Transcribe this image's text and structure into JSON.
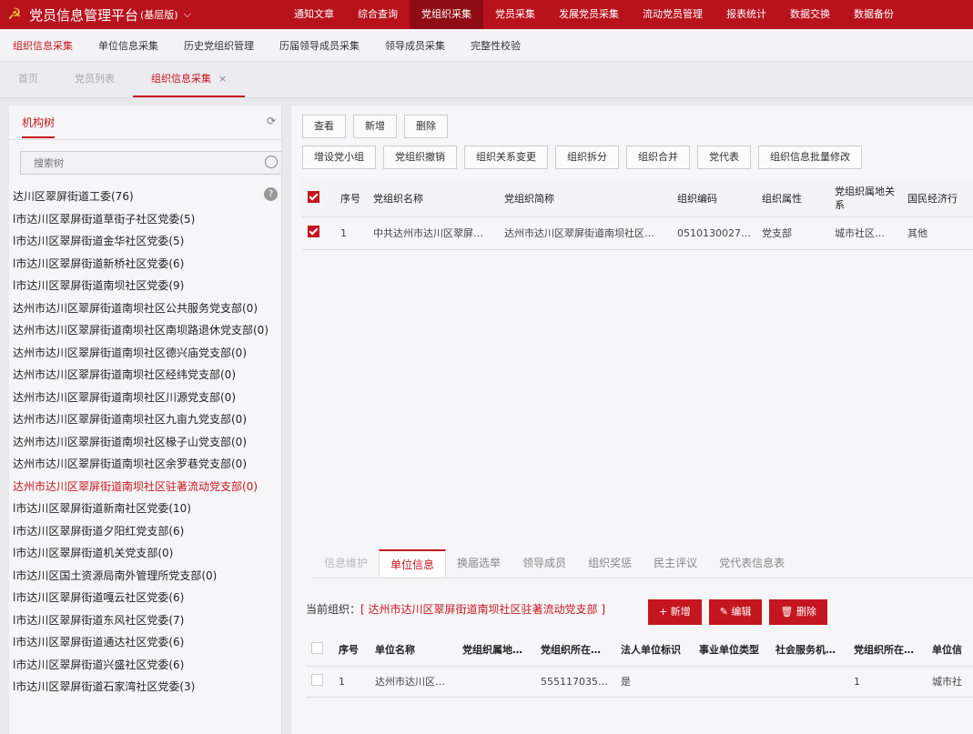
{
  "app": {
    "title": "党员信息管理平台",
    "subtitle": "(基层版)"
  },
  "topnav": [
    "通知文章",
    "综合查询",
    "党组织采集",
    "党员采集",
    "发展党员采集",
    "流动党员管理",
    "报表统计",
    "数据交换",
    "数据备份"
  ],
  "subnav": [
    "组织信息采集",
    "单位信息采集",
    "历史党组织管理",
    "历届领导成员采集",
    "领导成员采集",
    "完整性校验"
  ],
  "tabs": [
    "首页",
    "党员列表",
    "组织信息采集"
  ],
  "left": {
    "title": "机构树",
    "search_placeholder": "搜索树",
    "tree": [
      "达川区翠屏街道工委(76)",
      "l市达川区翠屏街道草街子社区党委(5)",
      "l市达川区翠屏街道金华社区党委(5)",
      "l市达川区翠屏街道新桥社区党委(6)",
      "l市达川区翠屏街道南坝社区党委(9)",
      "达州市达川区翠屏街道南坝社区公共服务党支部(0)",
      "达州市达川区翠屏街道南坝社区南坝路退休党支部(0)",
      "达州市达川区翠屏街道南坝社区德兴庙党支部(0)",
      "达州市达川区翠屏街道南坝社区经纬党支部(0)",
      "达州市达川区翠屏街道南坝社区川源党支部(0)",
      "达州市达川区翠屏街道南坝社区九亩九党支部(0)",
      "达州市达川区翠屏街道南坝社区椽子山党支部(0)",
      "达州市达川区翠屏街道南坝社区余罗巷党支部(0)",
      "达州市达川区翠屏街道南坝社区驻著流动党支部(0)",
      "l市达川区翠屏街道新南社区党委(10)",
      "l市达川区翠屏街道夕阳红党支部(6)",
      "l市达川区翠屏街道机关党支部(0)",
      "l市达川区国土资源局南外管理所党支部(0)",
      "l市达川区翠屏街道嘎云社区党委(6)",
      "l市达川区翠屏街道东风社区党委(7)",
      "l市达川区翠屏街道通达社区党委(6)",
      "l市达川区翠屏街道兴盛社区党委(6)",
      "l市达川区翠屏街道石家湾社区党委(3)"
    ],
    "selected_index": 13
  },
  "toolbar1": [
    "查看",
    "新增",
    "删除"
  ],
  "toolbar2": [
    "增设党小组",
    "党组织撤销",
    "组织关系变更",
    "组织拆分",
    "组织合并",
    "党代表",
    "组织信息批量修改"
  ],
  "grid": {
    "headers": [
      "序号",
      "党组织名称",
      "党组织简称",
      "组织编码",
      "组织属性",
      "党组织属地关系",
      "国民经济行"
    ],
    "rows": [
      [
        "1",
        "中共达州市达川区翠屏…",
        "达州市达川区翠屏街道南坝社区…",
        "0510130027…",
        "党支部",
        "城市社区…",
        "其他"
      ]
    ]
  },
  "bottom_tabs": [
    "信息维护",
    "单位信息",
    "换届选举",
    "领导成员",
    "组织奖惩",
    "民主评议",
    "党代表信息表"
  ],
  "current_org_label": "当前组织：",
  "current_org": "[ 达州市达川区翠屏街道南坝社区驻著流动党支部 ]",
  "actions": [
    "+ 新增",
    "✎ 编辑",
    "🗑 删除"
  ],
  "grid2": {
    "headers": [
      "序号",
      "单位名称",
      "党组织属地…",
      "党组织所在…",
      "法人单位标识",
      "事业单位类型",
      "社会服务机…",
      "党组织所在…",
      "单位信"
    ],
    "rows": [
      [
        "1",
        "达州市达川区…",
        "",
        "555117035…",
        "是",
        "",
        "",
        "1",
        "城市社"
      ]
    ]
  }
}
